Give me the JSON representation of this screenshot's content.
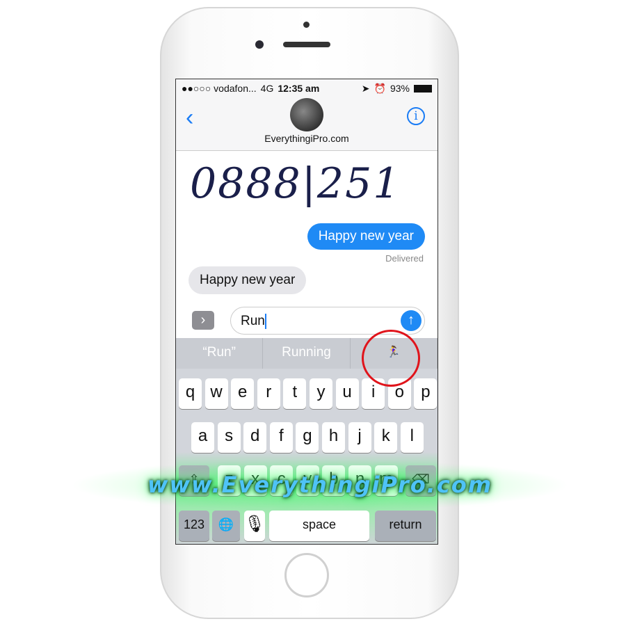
{
  "status": {
    "carrier": "●●○○○ vodafon...",
    "network": "4G",
    "time": "12:35 am",
    "battery": "93%"
  },
  "nav": {
    "back_icon": "chevron-left-icon",
    "contact": "EverythingiPro.com",
    "info_icon": "info-icon"
  },
  "messages": {
    "handwritten": "0888|251",
    "sent": "Happy new year",
    "sent_status": "Delivered",
    "received": "Happy new year"
  },
  "compose": {
    "value": "Run",
    "apps_icon": "chevron-right-icon",
    "send_icon": "arrow-up-icon"
  },
  "predictions": [
    "“Run”",
    "Running",
    "🏃‍♀️"
  ],
  "keyboard": {
    "row1": [
      "q",
      "w",
      "e",
      "r",
      "t",
      "y",
      "u",
      "i",
      "o",
      "p"
    ],
    "row2": [
      "a",
      "s",
      "d",
      "f",
      "g",
      "h",
      "j",
      "k",
      "l"
    ],
    "row3": [
      "z",
      "x",
      "c",
      "v",
      "b",
      "n",
      "m"
    ],
    "numbers": "123",
    "space": "space",
    "return": "return"
  },
  "watermark": "www.EverythingiPro.com",
  "colors": {
    "accent": "#1f8af5",
    "highlight_circle": "#e0141b"
  }
}
